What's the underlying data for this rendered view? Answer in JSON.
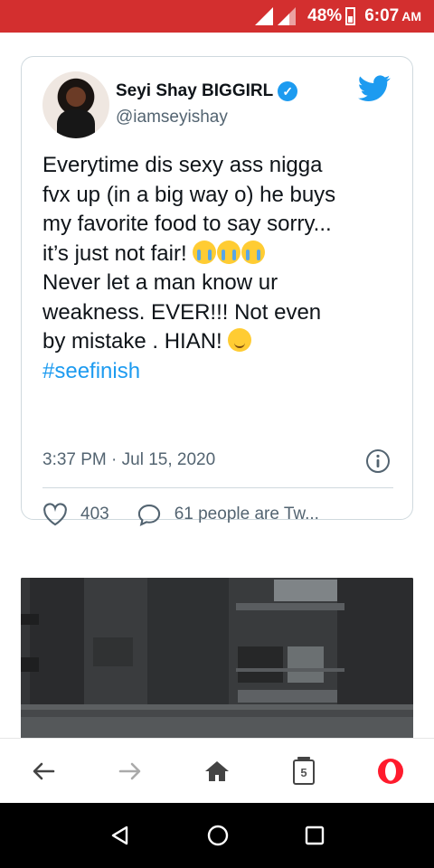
{
  "status_bar": {
    "battery": "48%",
    "time": "6:07",
    "ampm": "AM",
    "background": "#d32f2f"
  },
  "tweet": {
    "display_name": "Seyi Shay BIGGIRL",
    "handle": "@iamseyishay",
    "verified": true,
    "text_lines": [
      "Everytime dis sexy ass nigga",
      "fvx up (in a big way o) he buys",
      "my favorite food to say sorry...",
      "it’s just not fair!",
      "Never let a man know ur",
      "weakness. EVER!!! Not even",
      "by mistake . HIAN!"
    ],
    "hashtag": "#seefinish",
    "timestamp": "3:37 PM · Jul 15, 2020",
    "like_count": "403",
    "reply_text": "61 people are Tw...",
    "accent": "#1d9bf0",
    "emoji_line4": [
      "loudly-crying-face",
      "loudly-crying-face",
      "loudly-crying-face"
    ],
    "emoji_line7": "smirking-face"
  },
  "browser_nav": {
    "tab_count": "5",
    "icons": [
      "back-arrow-icon",
      "forward-arrow-icon",
      "home-icon",
      "tabs-icon",
      "opera-logo-icon"
    ]
  },
  "android_nav": {
    "icons": [
      "back-triangle-icon",
      "home-circle-icon",
      "recents-square-icon"
    ]
  }
}
